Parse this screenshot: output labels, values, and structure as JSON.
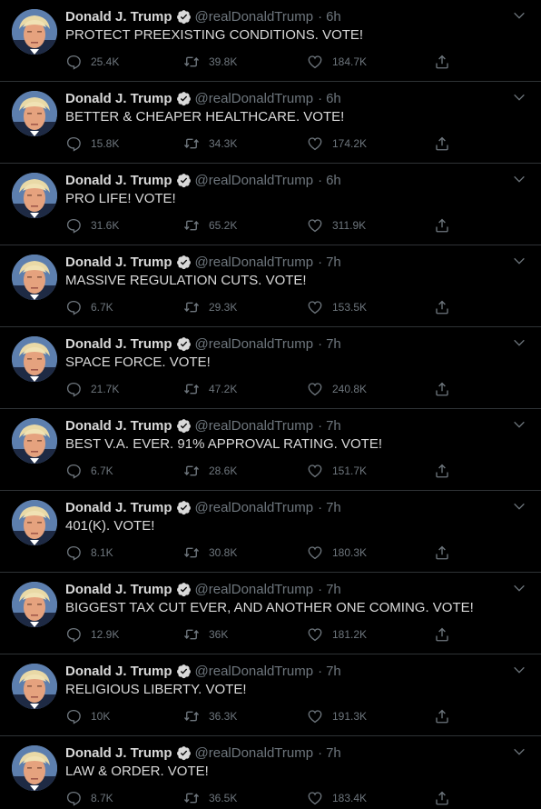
{
  "author": {
    "name": "Donald J. Trump",
    "handle": "@realDonaldTrump",
    "separator": "·",
    "avatar_icon": "profile-photo",
    "verified_icon": "verified-badge-icon"
  },
  "colors": {
    "background": "#000000",
    "text": "#d9d9d9",
    "muted": "#6e767d",
    "divider": "#2f3336"
  },
  "tweets": [
    {
      "time": "6h",
      "text": "PROTECT PREEXISTING CONDITIONS. VOTE!",
      "replies": "25.4K",
      "retweets": "39.8K",
      "likes": "184.7K"
    },
    {
      "time": "6h",
      "text": "BETTER & CHEAPER HEALTHCARE. VOTE!",
      "replies": "15.8K",
      "retweets": "34.3K",
      "likes": "174.2K"
    },
    {
      "time": "6h",
      "text": "PRO LIFE! VOTE!",
      "replies": "31.6K",
      "retweets": "65.2K",
      "likes": "311.9K"
    },
    {
      "time": "7h",
      "text": "MASSIVE REGULATION CUTS. VOTE!",
      "replies": "6.7K",
      "retweets": "29.3K",
      "likes": "153.5K"
    },
    {
      "time": "7h",
      "text": "SPACE FORCE. VOTE!",
      "replies": "21.7K",
      "retweets": "47.2K",
      "likes": "240.8K"
    },
    {
      "time": "7h",
      "text": "BEST V.A. EVER. 91% APPROVAL RATING. VOTE!",
      "replies": "6.7K",
      "retweets": "28.6K",
      "likes": "151.7K"
    },
    {
      "time": "7h",
      "text": "401(K). VOTE!",
      "replies": "8.1K",
      "retweets": "30.8K",
      "likes": "180.3K"
    },
    {
      "time": "7h",
      "text": "BIGGEST TAX CUT EVER, AND ANOTHER ONE COMING. VOTE!",
      "replies": "12.9K",
      "retweets": "36K",
      "likes": "181.2K"
    },
    {
      "time": "7h",
      "text": "RELIGIOUS LIBERTY. VOTE!",
      "replies": "10K",
      "retweets": "36.3K",
      "likes": "191.3K"
    },
    {
      "time": "7h",
      "text": "LAW & ORDER. VOTE!",
      "replies": "8.7K",
      "retweets": "36.5K",
      "likes": "183.4K"
    }
  ]
}
